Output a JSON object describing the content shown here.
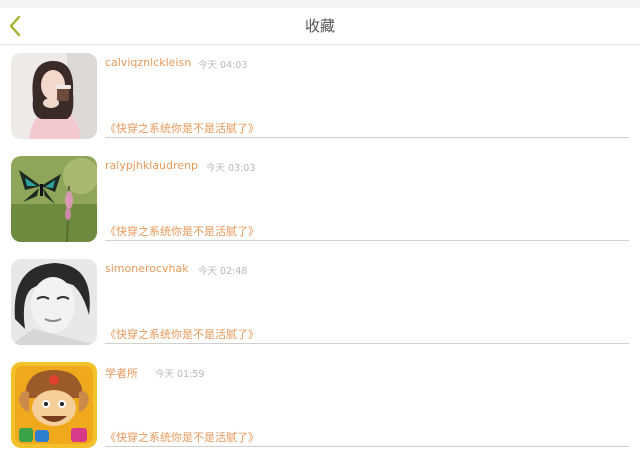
{
  "header": {
    "title": "收藏",
    "back_icon": "chevron-left-icon",
    "back_color": "#a4b12c"
  },
  "accent_color": "#e8995a",
  "favorites": [
    {
      "user": "calviqznlckleisn",
      "time": "今天 04:03",
      "book": "《快穿之系统你是不是活腻了》",
      "avatar": "girl-photo-avatar"
    },
    {
      "user": "ralypjhklaudrenp",
      "time": "今天 03:03",
      "book": "《快穿之系统你是不是活腻了》",
      "avatar": "butterfly-photo-avatar"
    },
    {
      "user": "simonerocvhak",
      "time": "今天 02:48",
      "book": "《快穿之系统你是不是活腻了》",
      "avatar": "bw-portrait-avatar"
    },
    {
      "user": "学者所",
      "time": "今天 01:59",
      "book": "《快穿之系统你是不是活腻了》",
      "avatar": "cartoon-game-avatar"
    }
  ]
}
